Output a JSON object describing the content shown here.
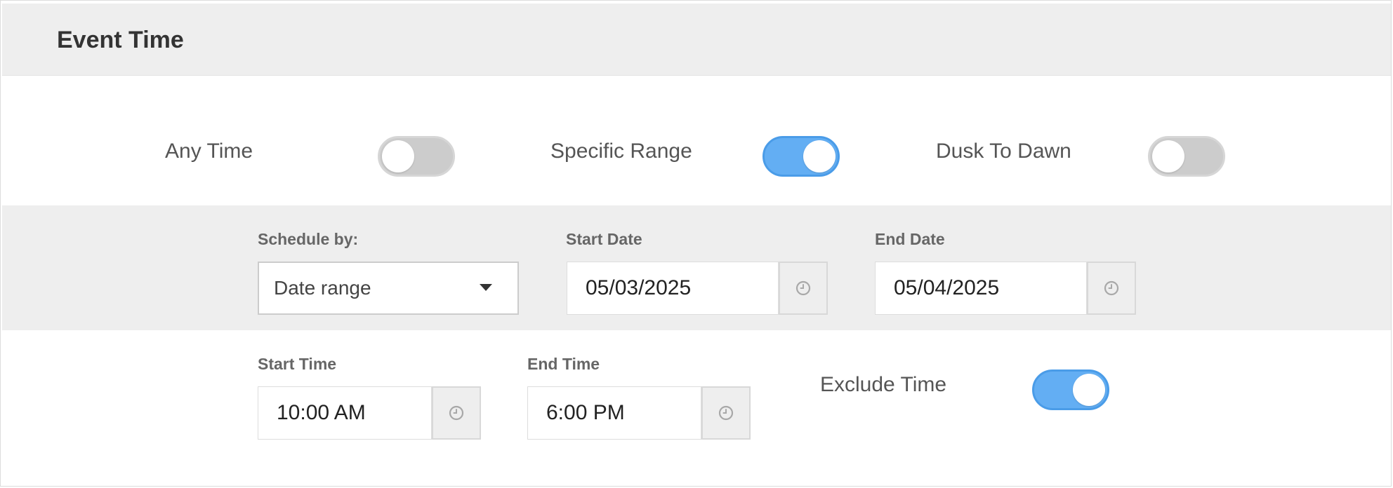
{
  "section": {
    "title": "Event Time"
  },
  "modes": {
    "any_time": {
      "label": "Any Time",
      "enabled": false
    },
    "specific_range": {
      "label": "Specific Range",
      "enabled": true
    },
    "dusk_to_dawn": {
      "label": "Dusk To Dawn",
      "enabled": false
    }
  },
  "schedule": {
    "label": "Schedule by:",
    "selected": "Date range"
  },
  "start_date": {
    "label": "Start Date",
    "value": "05/03/2025",
    "icon": "clock-icon"
  },
  "end_date": {
    "label": "End Date",
    "value": "05/04/2025",
    "icon": "clock-icon"
  },
  "start_time": {
    "label": "Start Time",
    "value": "10:00 AM",
    "icon": "clock-icon"
  },
  "end_time": {
    "label": "End Time",
    "value": "6:00 PM",
    "icon": "clock-icon"
  },
  "exclude_time": {
    "label": "Exclude Time",
    "enabled": true
  },
  "colors": {
    "toggle_on": "#63aef3",
    "toggle_off": "#cccccc",
    "band_background": "#eeeeee"
  }
}
